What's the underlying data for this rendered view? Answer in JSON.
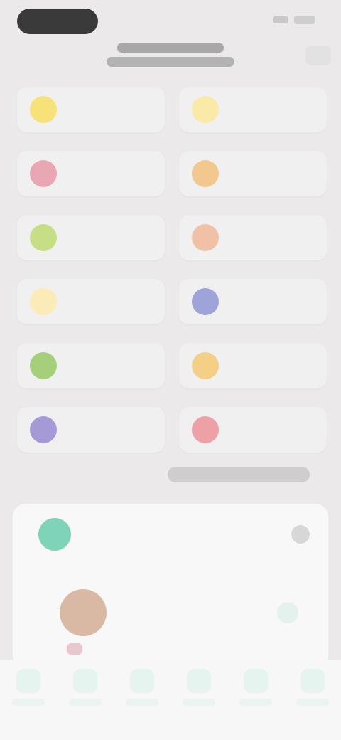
{
  "status_bar": {
    "time": ""
  },
  "header": {
    "title": "",
    "subtitle": ""
  },
  "categories": [
    {
      "icon": "sun-icon",
      "color": "#f7e27a",
      "label": ""
    },
    {
      "icon": "sun-icon",
      "color": "#fbeaa7",
      "label": ""
    },
    {
      "icon": "heart-icon",
      "color": "#e8a7b3",
      "label": ""
    },
    {
      "icon": "star-icon",
      "color": "#f2c88f",
      "label": ""
    },
    {
      "icon": "leaf-icon",
      "color": "#c6df86",
      "label": ""
    },
    {
      "icon": "flower-icon",
      "color": "#f1c1a5",
      "label": ""
    },
    {
      "icon": "moon-icon",
      "color": "#fbebb8",
      "label": ""
    },
    {
      "icon": "drop-icon",
      "color": "#9ea3d9",
      "label": ""
    },
    {
      "icon": "plant-icon",
      "color": "#a6cf7b",
      "label": ""
    },
    {
      "icon": "bell-icon",
      "color": "#f5cf86",
      "label": ""
    },
    {
      "icon": "grape-icon",
      "color": "#a69ad6",
      "label": ""
    },
    {
      "icon": "apple-icon",
      "color": "#eea0a7",
      "label": ""
    }
  ],
  "more_link": "",
  "card": {
    "name": "",
    "subtitle": "",
    "photo_caption": ""
  },
  "tabs": [
    {
      "icon": "home-icon",
      "label": ""
    },
    {
      "icon": "explore-icon",
      "label": ""
    },
    {
      "icon": "list-icon",
      "label": ""
    },
    {
      "icon": "message-icon",
      "label": ""
    },
    {
      "icon": "cart-icon",
      "label": ""
    },
    {
      "icon": "profile-icon",
      "label": ""
    }
  ]
}
